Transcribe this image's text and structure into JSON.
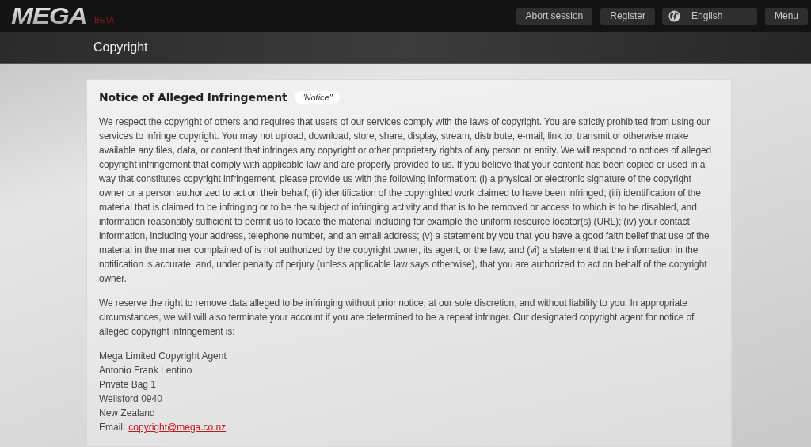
{
  "header": {
    "logo": "MEGA",
    "badge": "BETA",
    "buttons": [
      {
        "label": "Abort session",
        "kind": "plain"
      },
      {
        "label": "Register",
        "kind": "plain"
      },
      {
        "label": "English",
        "kind": "language"
      },
      {
        "label": "Menu",
        "kind": "plain"
      }
    ]
  },
  "page_title": "Copyright",
  "notice": {
    "title": "Notice of Alleged Infringement",
    "tag": "\"Notice\"",
    "paragraphs": [
      "We respect the copyright of others and requires that users of our services comply with the laws of copyright. You are strictly prohibited from using our services to infringe copyright. You may not upload, download, store, share, display, stream, distribute, e-mail, link to, transmit or otherwise make available any files, data, or content that infringes any copyright or other proprietary rights of any person or entity. We will respond to notices of alleged copyright infringement that comply with applicable law and are properly provided to us. If you believe that your content has been copied or used in a way that constitutes copyright infringement, please provide us with the following information: (i) a physical or electronic signature of the copyright owner or a person authorized to act on their behalf; (ii) identification of the copyrighted work claimed to have been infringed; (iii) identification of the material that is claimed to be infringing or to be the subject of infringing activity and that is to be removed or access to which is to be disabled, and information reasonably sufficient to permit us to locate the material including for example the uniform resource locator(s) (URL); (iv) your contact information, including your address, telephone number, and an email address; (v) a statement by you that you have a good faith belief that use of the material in the manner complained of is not authorized by the copyright owner, its agent, or the law; and (vi) a statement that the information in the notification is accurate, and, under penalty of perjury (unless applicable law says otherwise), that you are authorized to act on behalf of the copyright owner.",
      "We reserve the right to remove data alleged to be infringing without prior notice, at our sole discretion, and without liability to you. In appropriate circumstances, we will will also terminate your account if you are determined to be a repeat infringer. Our designated copyright agent for notice of alleged copyright infringement is:"
    ],
    "address": [
      "Mega Limited Copyright Agent",
      "Antonio Frank Lentino",
      "Private Bag 1",
      "Wellsford 0940",
      "New Zealand"
    ],
    "email": {
      "label": "Email:",
      "link": "copyright@mega.co.nz"
    }
  }
}
